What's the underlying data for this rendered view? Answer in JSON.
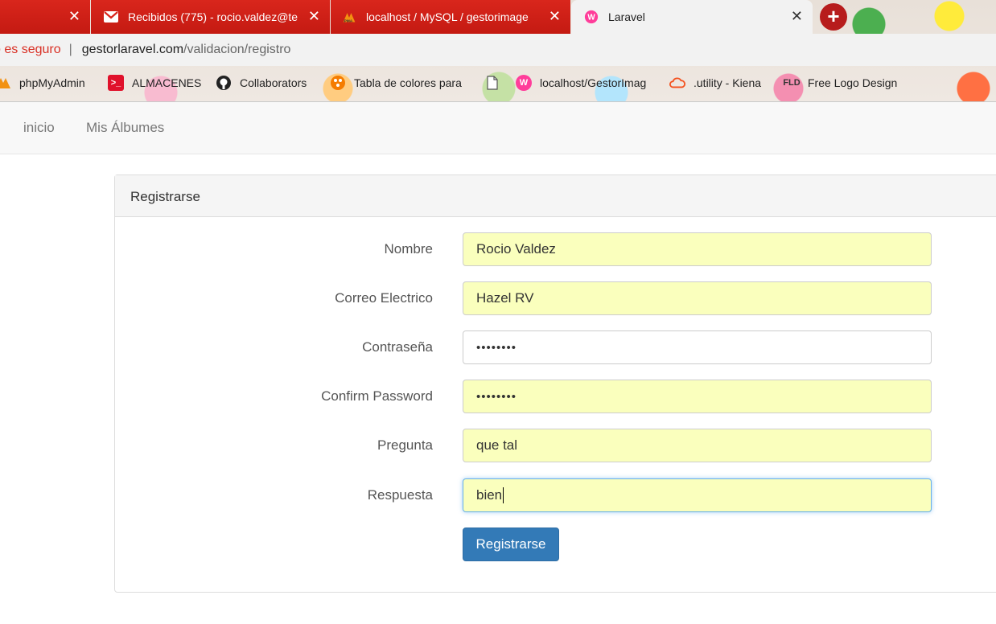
{
  "browser": {
    "tabs": [
      {
        "title": "",
        "icon": "close-icon"
      },
      {
        "title": "Recibidos (775) - rocio.valdez@te",
        "icon": "gmail-icon"
      },
      {
        "title": "localhost / MySQL / gestorimage",
        "icon": "phpmyadmin-icon"
      },
      {
        "title": "Laravel",
        "icon": "laravel-icon"
      }
    ],
    "new_tab_label": "+",
    "address": {
      "security_label": "o es seguro",
      "separator": "|",
      "host": "gestorlaravel.com",
      "path": "/validacion/registro"
    },
    "bookmarks": [
      {
        "label": "phpMyAdmin",
        "icon": "phpmyadmin-icon",
        "icon_text": "PMA"
      },
      {
        "label": "ALMACENES",
        "icon": "terminal-icon",
        "icon_text": ">_"
      },
      {
        "label": "Collaborators",
        "icon": "github-icon",
        "icon_text": ""
      },
      {
        "label": "Tabla de colores para",
        "icon": "palette-icon",
        "icon_text": ""
      },
      {
        "label": "",
        "icon": "page-icon",
        "icon_text": ""
      },
      {
        "label": "localhost/GestorImag",
        "icon": "wamp-icon",
        "icon_text": "W"
      },
      {
        "label": ".utility - Kiena",
        "icon": "cloud-icon",
        "icon_text": ""
      },
      {
        "label": "Free Logo Design",
        "icon": "fld-icon",
        "icon_text": "FLD"
      }
    ]
  },
  "nav": {
    "items": [
      {
        "label": "inicio"
      },
      {
        "label": "Mis Álbumes"
      }
    ]
  },
  "panel": {
    "title": "Registrarse"
  },
  "form": {
    "fields": [
      {
        "label": "Nombre",
        "value": "Rocio Valdez"
      },
      {
        "label": "Correo Electrico",
        "value": "Hazel RV"
      },
      {
        "label": "Contraseña",
        "value": "••••••••"
      },
      {
        "label": "Confirm Password",
        "value": "••••••••"
      },
      {
        "label": "Pregunta",
        "value": "que tal"
      },
      {
        "label": "Respuesta",
        "value": "bien"
      }
    ],
    "submit_label": "Registrarse"
  },
  "colors": {
    "tab_red": "#c41a12",
    "autofill_yellow": "#faffbd",
    "primary_button": "#337ab7",
    "insecure_red": "#d93025"
  }
}
